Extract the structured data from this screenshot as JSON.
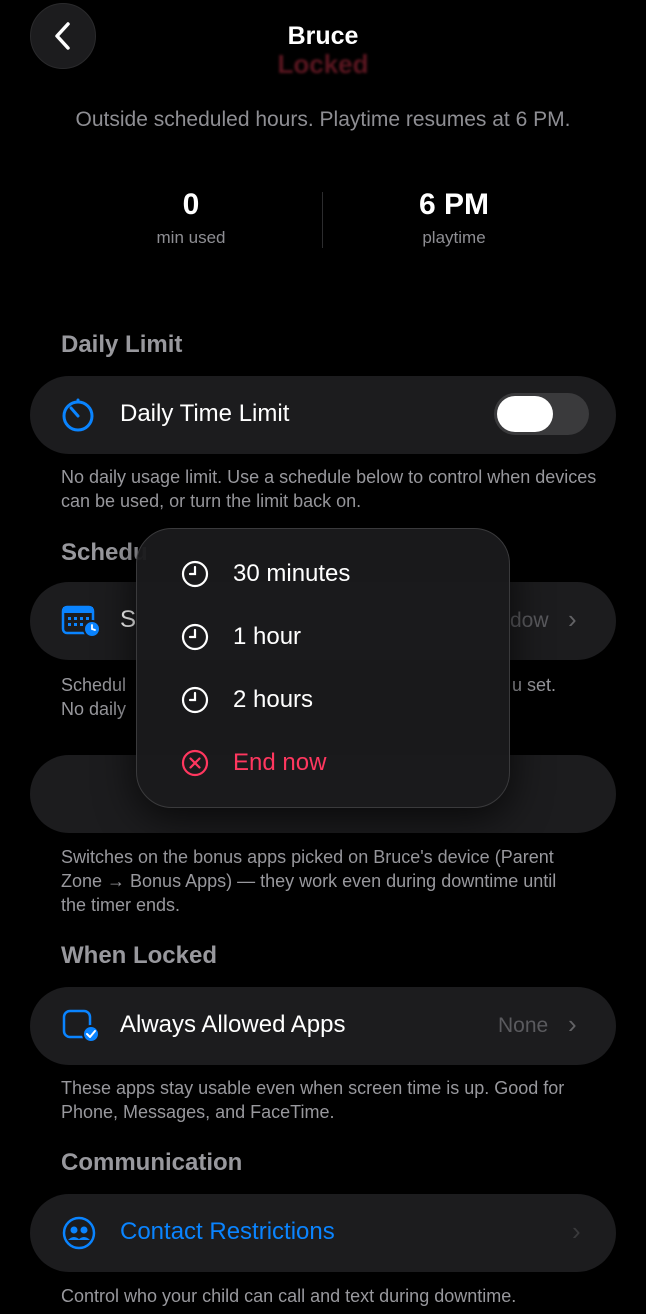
{
  "header": {
    "title": "Bruce",
    "status_badge": "Locked",
    "status_text": "Outside scheduled hours. Playtime resumes at 6 PM."
  },
  "stats": [
    {
      "value": "0",
      "label": "min used"
    },
    {
      "value": "6 PM",
      "label": "playtime"
    }
  ],
  "daily_limit": {
    "section_title": "Daily Limit",
    "row_label": "Daily Time Limit",
    "toggle_on": false,
    "description": "No daily usage limit. Use a schedule below to control when devices can be used, or turn the limit back on."
  },
  "schedule": {
    "section_title_visible": "Schedu",
    "row_label_visible": "S",
    "row_value_visible": "dow",
    "description_line1_start": "Schedul",
    "description_line1_end": "u set.",
    "description_line2_start": "No daily"
  },
  "bonus": {
    "description": "Switches on the bonus apps picked on Bruce's device (Parent Zone → Bonus Apps) — they work even during downtime until the timer ends."
  },
  "when_locked": {
    "section_title": "When Locked",
    "row_label": "Always Allowed Apps",
    "row_value": "None",
    "description": "These apps stay usable even when screen time is up. Good for Phone, Messages, and FaceTime."
  },
  "communication": {
    "section_title": "Communication",
    "row_label": "Contact Restrictions",
    "description": "Control who your child can call and text during downtime."
  },
  "popup_menu": {
    "items": [
      {
        "label": "30 minutes",
        "icon": "clock-icon"
      },
      {
        "label": "1 hour",
        "icon": "clock-icon"
      },
      {
        "label": "2 hours",
        "icon": "clock-icon"
      },
      {
        "label": "End now",
        "icon": "x-circle-icon"
      }
    ]
  },
  "colors": {
    "accent_blue": "#0a84ff",
    "danger_red": "#ff375f",
    "background": "#000000",
    "card": "#1c1c1e"
  }
}
